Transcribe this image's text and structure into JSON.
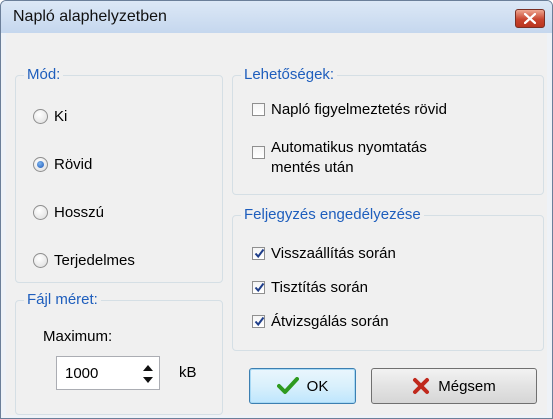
{
  "window": {
    "title": "Napló alaphelyzetben"
  },
  "mode": {
    "legend": "Mód:",
    "options": [
      {
        "label": "Ki",
        "selected": false
      },
      {
        "label": "Rövid",
        "selected": true
      },
      {
        "label": "Hosszú",
        "selected": false
      },
      {
        "label": "Terjedelmes",
        "selected": false
      }
    ]
  },
  "file_size": {
    "legend": "Fájl méret:",
    "max_label": "Maximum:",
    "value": "1000",
    "unit": "kB"
  },
  "options": {
    "legend": "Lehetőségek:",
    "items": [
      {
        "label": "Napló figyelmeztetés rövid",
        "checked": false
      },
      {
        "label_line1": "Automatikus nyomtatás",
        "label_line2": "mentés után",
        "checked": false
      }
    ]
  },
  "logging": {
    "legend": "Feljegyzés engedélyezése",
    "items": [
      {
        "label": "Visszaállítás során",
        "checked": true
      },
      {
        "label": "Tisztítás során",
        "checked": true
      },
      {
        "label": "Átvizsgálás során",
        "checked": true
      }
    ]
  },
  "buttons": {
    "ok": "OK",
    "cancel": "Mégsem"
  },
  "colors": {
    "legend_text": "#1e5ebd",
    "ok_icon": "#2e9a1f",
    "cancel_icon": "#c0281c"
  }
}
